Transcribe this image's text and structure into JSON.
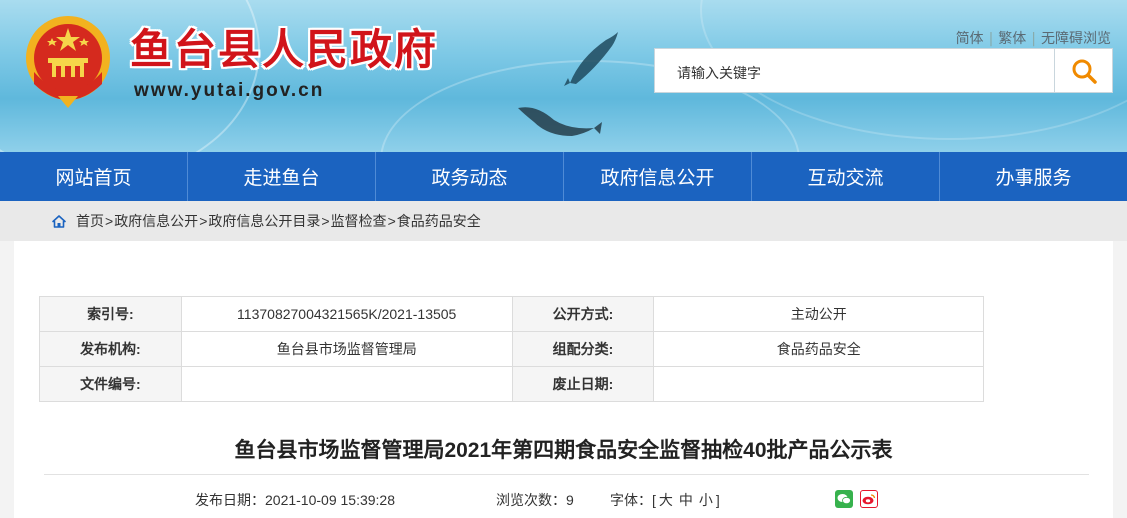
{
  "site": {
    "name": "鱼台县人民政府",
    "url": "www.yutai.gov.cn"
  },
  "top_links": [
    "简体",
    "繁体",
    "无障碍浏览"
  ],
  "search": {
    "placeholder": "请输入关键字",
    "icon": "search-icon"
  },
  "nav": [
    "网站首页",
    "走进鱼台",
    "政务动态",
    "政府信息公开",
    "互动交流",
    "办事服务"
  ],
  "breadcrumb": [
    "首页",
    "政府信息公开",
    "政府信息公开目录",
    "监督检查",
    "食品药品安全"
  ],
  "meta": {
    "index_label": "索引号:",
    "index_value": "11370827004321565K/2021-13505",
    "disclosure_label": "公开方式:",
    "disclosure_value": "主动公开",
    "publisher_label": "发布机构:",
    "publisher_value": "鱼台县市场监督管理局",
    "category_label": "组配分类:",
    "category_value": "食品药品安全",
    "docno_label": "文件编号:",
    "docno_value": "",
    "expiry_label": "废止日期:",
    "expiry_value": ""
  },
  "article": {
    "title": "鱼台县市场监督管理局2021年第四期食品安全监督抽检40批产品公示表",
    "date_label": "发布日期：",
    "date_value": "2021-10-09 15:39:28",
    "views_label": "浏览次数：",
    "views_value": "9",
    "font_label": "字体：[",
    "font_large": "大",
    "font_medium": "中",
    "font_small": "小",
    "font_end": "]"
  },
  "colors": {
    "brand_red": "#d1141a",
    "nav_blue": "#1b63c0",
    "search_orange": "#f08a00",
    "wechat_green": "#37b24d",
    "weibo_red": "#e6162d"
  }
}
